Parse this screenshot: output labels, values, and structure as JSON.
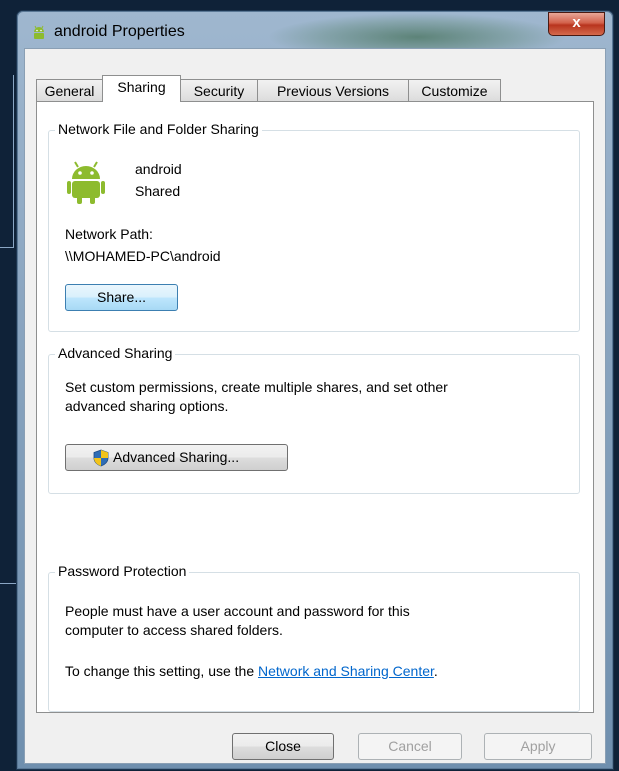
{
  "window": {
    "title": "android Properties",
    "close_glyph": "x"
  },
  "tabs": [
    {
      "label": "General"
    },
    {
      "label": "Sharing"
    },
    {
      "label": "Security"
    },
    {
      "label": "Previous Versions"
    },
    {
      "label": "Customize"
    }
  ],
  "network_sharing": {
    "legend": "Network File and Folder Sharing",
    "folder_name": "android",
    "folder_state": "Shared",
    "path_label": "Network Path:",
    "path_value": "\\\\MOHAMED-PC\\android",
    "share_button": "Share..."
  },
  "advanced_sharing": {
    "legend": "Advanced Sharing",
    "description_line1": "Set custom permissions, create multiple shares, and set other",
    "description_line2": "advanced sharing options.",
    "button": "Advanced Sharing..."
  },
  "password_protection": {
    "legend": "Password Protection",
    "description_line1": "People must have a user account and password for this",
    "description_line2": "computer to access shared folders.",
    "change_prefix": "To change this setting, use the ",
    "link_text": "Network and Sharing Center",
    "change_suffix": "."
  },
  "footer": {
    "close": "Close",
    "cancel": "Cancel",
    "apply": "Apply"
  },
  "colors": {
    "link": "#0066cc",
    "android_green": "#8dbb2e",
    "shield_blue": "#2f6db5",
    "shield_yellow": "#f2c31a"
  }
}
